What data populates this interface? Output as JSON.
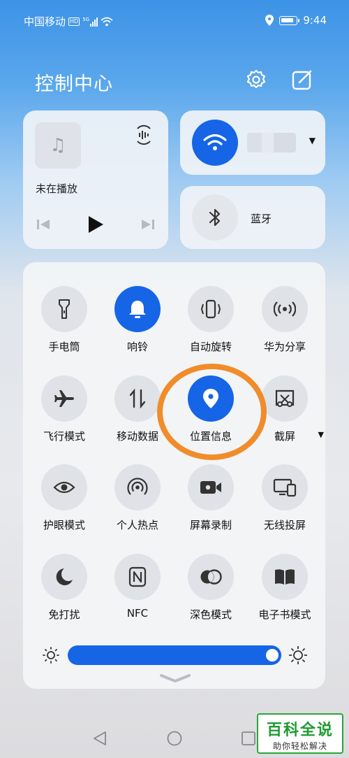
{
  "status": {
    "carrier": "中国移动",
    "hd_badge": "HD",
    "network": "5G",
    "time": "9:44"
  },
  "header": {
    "title": "控制中心"
  },
  "media": {
    "now_playing": "未在播放"
  },
  "wifi": {
    "network_name": ""
  },
  "bluetooth": {
    "label": "蓝牙"
  },
  "tiles": [
    {
      "label": "手电筒",
      "icon": "flashlight-icon",
      "active": false
    },
    {
      "label": "响铃",
      "icon": "bell-icon",
      "active": true
    },
    {
      "label": "自动旋转",
      "icon": "auto-rotate-icon",
      "active": false
    },
    {
      "label": "华为分享",
      "icon": "huawei-share-icon",
      "active": false
    },
    {
      "label": "飞行模式",
      "icon": "airplane-icon",
      "active": false
    },
    {
      "label": "移动数据",
      "icon": "mobile-data-icon",
      "active": false
    },
    {
      "label": "位置信息",
      "icon": "location-icon",
      "active": true
    },
    {
      "label": "截屏",
      "icon": "screenshot-icon",
      "active": false
    },
    {
      "label": "护眼模式",
      "icon": "eye-comfort-icon",
      "active": false
    },
    {
      "label": "个人热点",
      "icon": "hotspot-icon",
      "active": false
    },
    {
      "label": "屏幕录制",
      "icon": "screen-record-icon",
      "active": false
    },
    {
      "label": "无线投屏",
      "icon": "wireless-projection-icon",
      "active": false
    },
    {
      "label": "免打扰",
      "icon": "do-not-disturb-icon",
      "active": false
    },
    {
      "label": "NFC",
      "icon": "nfc-icon",
      "active": false
    },
    {
      "label": "深色模式",
      "icon": "dark-mode-icon",
      "active": false
    },
    {
      "label": "电子书模式",
      "icon": "ebook-mode-icon",
      "active": false
    }
  ],
  "brightness": {
    "level": 0.98
  },
  "watermark": {
    "title": "百科全说",
    "subtitle": "助你轻松解决"
  },
  "colors": {
    "accent": "#1565e6",
    "highlight": "#f08c2a",
    "watermark_green": "#1f9a30"
  }
}
